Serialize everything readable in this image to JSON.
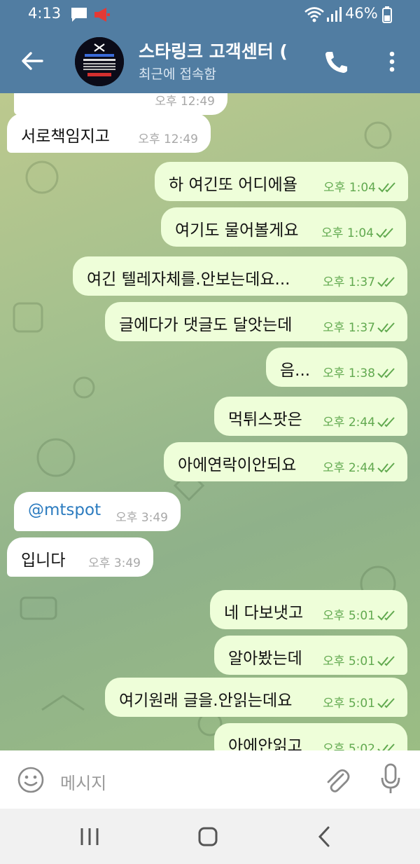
{
  "status_bar": {
    "time": "4:13",
    "battery": "46%"
  },
  "header": {
    "title": "스타링크 고객센터 (",
    "subtitle": "최근에 접속함"
  },
  "messages": [
    {
      "text": "",
      "time": "오후 12:49"
    },
    {
      "text": "서로책임지고",
      "time": "오후 12:49"
    },
    {
      "text": "하 여긴또 어디에욜",
      "time": "오후 1:04"
    },
    {
      "text": "여기도 물어볼게요",
      "time": "오후 1:04"
    },
    {
      "text": "여긴 텔레자체를.안보는데요...",
      "time": "오후 1:37"
    },
    {
      "text": "글에다가 댓글도 달앗는데",
      "time": "오후 1:37"
    },
    {
      "text": "음...",
      "time": "오후 1:38"
    },
    {
      "text": "먹튀스팟은",
      "time": "오후 2:44"
    },
    {
      "text": "아에연락이안되요",
      "time": "오후 2:44"
    },
    {
      "text": "@mtspot",
      "time": "오후 3:49"
    },
    {
      "text": "입니다",
      "time": "오후 3:49"
    },
    {
      "text": "네 다보냇고",
      "time": "오후 5:01"
    },
    {
      "text": "알아봤는데",
      "time": "오후 5:01"
    },
    {
      "text": "여기원래 글을.안읽는데요",
      "time": "오후 5:01"
    },
    {
      "text": "아에안읽고",
      "time": "오후 5:02"
    }
  ],
  "composer": {
    "placeholder": "메시지"
  },
  "colors": {
    "header": "#517da2",
    "outgoing_bubble": "#eefed9",
    "incoming_bubble": "#ffffff",
    "read_check": "#61a94f"
  },
  "icons": [
    "back-arrow-icon",
    "phone-icon",
    "more-vert-icon",
    "emoji-icon",
    "attach-icon",
    "mic-icon",
    "recents-icon",
    "home-icon",
    "back-nav-icon"
  ]
}
